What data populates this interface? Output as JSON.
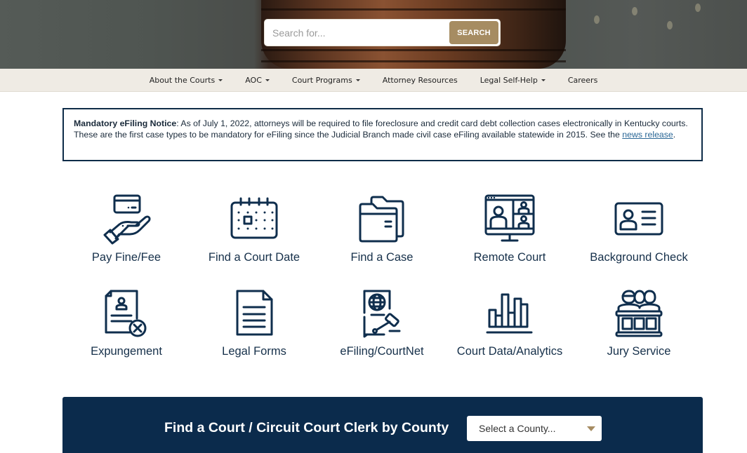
{
  "search": {
    "placeholder": "Search for...",
    "button_label": "SEARCH"
  },
  "nav": {
    "items": [
      {
        "label": "About the Courts",
        "has_dropdown": true
      },
      {
        "label": "AOC",
        "has_dropdown": true
      },
      {
        "label": "Court Programs",
        "has_dropdown": true
      },
      {
        "label": "Attorney Resources",
        "has_dropdown": false
      },
      {
        "label": "Legal Self-Help",
        "has_dropdown": true
      },
      {
        "label": "Careers",
        "has_dropdown": false
      }
    ]
  },
  "notice": {
    "title": "Mandatory eFiling Notice",
    "body": ": As of July 1, 2022, attorneys will be required to file foreclosure and credit card debt collection cases electronically in Kentucky courts. These are the first case types to be mandatory for eFiling since the Judicial Branch made civil case eFiling available statewide in 2015. See the ",
    "link_text": "news release",
    "trailing": "."
  },
  "tiles": [
    {
      "label": "Pay Fine/Fee",
      "icon": "hand-card-icon"
    },
    {
      "label": "Find a Court Date",
      "icon": "calendar-icon"
    },
    {
      "label": "Find a Case",
      "icon": "folder-icon"
    },
    {
      "label": "Remote Court",
      "icon": "video-conference-icon"
    },
    {
      "label": "Background Check",
      "icon": "id-card-icon"
    },
    {
      "label": "Expungement",
      "icon": "document-remove-icon"
    },
    {
      "label": "Legal Forms",
      "icon": "document-icon"
    },
    {
      "label": "eFiling/CourtNet",
      "icon": "globe-gavel-document-icon"
    },
    {
      "label": "Court Data/Analytics",
      "icon": "bar-chart-icon"
    },
    {
      "label": "Jury Service",
      "icon": "jury-box-icon"
    }
  ],
  "county_finder": {
    "title": "Find a Court / Circuit Court Clerk by County",
    "select_value": "Select a County..."
  },
  "colors": {
    "primary_navy": "#0b2b4c",
    "accent_gold": "#a68c62",
    "nav_bg": "#efebe4",
    "link": "#2a6796"
  }
}
